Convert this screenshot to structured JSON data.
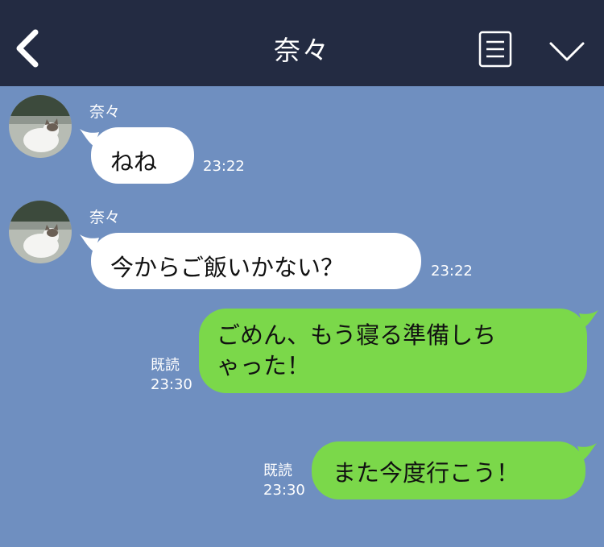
{
  "header": {
    "title": "奈々",
    "back_icon": "chevron-left-icon",
    "menu_icon": "menu-list-icon",
    "expand_icon": "chevron-down-icon"
  },
  "messages": [
    {
      "direction": "in",
      "sender": "奈々",
      "text": "ねね",
      "time": "23:22"
    },
    {
      "direction": "in",
      "sender": "奈々",
      "text": "今からご飯いかない？",
      "time": "23:22"
    },
    {
      "direction": "out",
      "lines": [
        "ごめん、もう寝る準備しち",
        "ゃった！"
      ],
      "read": "既読",
      "time": "23:30"
    },
    {
      "direction": "out",
      "text": "また今度行こう！",
      "read": "既読",
      "time": "23:30"
    }
  ],
  "colors": {
    "background": "#6f8fc0",
    "header": "#232b42",
    "incoming_bubble": "#ffffff",
    "outgoing_bubble": "#7bd84a"
  }
}
